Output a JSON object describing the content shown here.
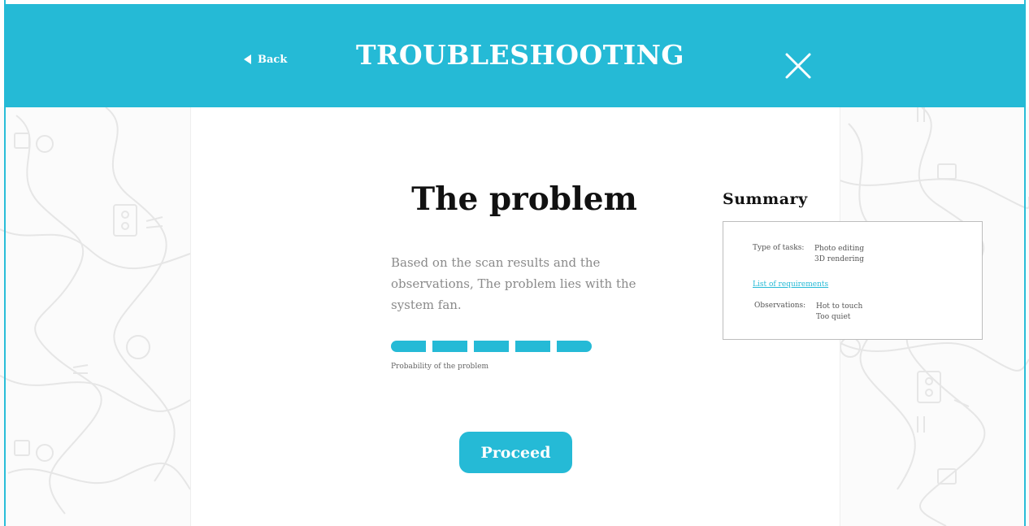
{
  "header": {
    "back_label": "Back",
    "title": "TROUBLESHOOTING"
  },
  "main": {
    "title": "The problem",
    "description": "Based on the scan results and the observations, The problem lies with the system fan.",
    "probability": {
      "caption": "Probability of the problem",
      "filled_segments": 5,
      "total_segments": 5
    },
    "proceed_label": "Proceed"
  },
  "summary": {
    "title": "Summary",
    "tasks_label": "Type of tasks:",
    "tasks": [
      "Photo editing",
      "3D rendering"
    ],
    "requirements_link": "List of requirements",
    "observations_label": "Observations:",
    "observations": [
      "Hot to touch",
      "Too quiet"
    ]
  },
  "colors": {
    "accent": "#25bad6",
    "text_dark": "#111111",
    "text_muted": "#8a8a8a"
  },
  "icons": {
    "back": "triangle-left-icon",
    "close": "close-x-icon"
  }
}
